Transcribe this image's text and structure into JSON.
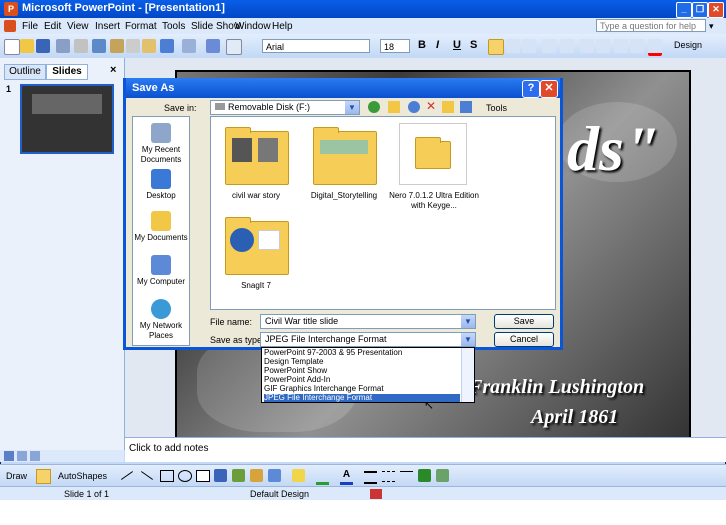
{
  "app": {
    "title": "Microsoft PowerPoint - [Presentation1]",
    "icon": "powerpoint-icon",
    "help_placeholder": "Type a question for help",
    "window_controls": [
      "_",
      "❐",
      "✕"
    ]
  },
  "menubar": {
    "items": [
      "File",
      "Edit",
      "View",
      "Insert",
      "Format",
      "Tools",
      "Slide Show",
      "Window",
      "Help"
    ]
  },
  "toolbar": {
    "font": "Arial",
    "font_size": "18",
    "bold": "B",
    "italic": "I",
    "underline": "U",
    "shadow": "S",
    "design_label": "Design"
  },
  "leftpane": {
    "tabs": [
      "Outline",
      "Slides"
    ],
    "slide_number": "1",
    "close": "×"
  },
  "slide": {
    "title_fragment": "ds\"",
    "author": "Franklin Lushington",
    "date": "April 1861"
  },
  "notes": {
    "placeholder": "Click to add notes"
  },
  "drawbar": {
    "draw_label": "Draw",
    "autoshapes_label": "AutoShapes"
  },
  "statusbar": {
    "slide": "Slide 1 of 1",
    "design": "Default Design"
  },
  "dialog": {
    "title": "Save As",
    "help": "?",
    "close": "✕",
    "save_in_label": "Save in:",
    "save_in_value": "Removable Disk (F:)",
    "tools_label": "Tools",
    "places": [
      "My Recent Documents",
      "Desktop",
      "My Documents",
      "My Computer",
      "My Network Places"
    ],
    "files": [
      {
        "name": "civil war story",
        "type": "folder"
      },
      {
        "name": "Digital_Storytelling",
        "type": "folder"
      },
      {
        "name": "Nero 7.0.1.2 Ultra Edition with Keyge...",
        "type": "folder"
      },
      {
        "name": "SnagIt 7",
        "type": "folder"
      }
    ],
    "file_name_label": "File name:",
    "file_name_value": "Civil War title slide",
    "save_as_type_label": "Save as type:",
    "save_as_type_value": "JPEG File Interchange Format",
    "save_button": "Save",
    "cancel_button": "Cancel",
    "type_options": [
      "PowerPoint 97-2003 & 95 Presentation",
      "Design Template",
      "PowerPoint Show",
      "PowerPoint Add-In",
      "GIF Graphics Interchange Format",
      "JPEG File Interchange Format"
    ]
  },
  "colors": {
    "titlebar": "#0a5ee8",
    "selection": "#316ac5",
    "dialog_bg": "#ece9d8",
    "folder": "#f5cd57"
  }
}
